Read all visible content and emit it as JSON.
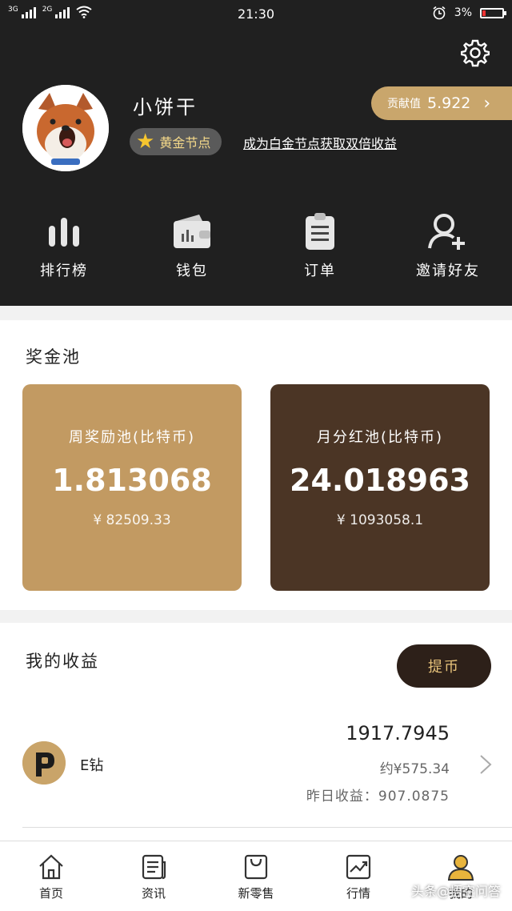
{
  "status_bar": {
    "net1": "3G",
    "net2": "2G",
    "time": "21:30",
    "battery_text": "3%"
  },
  "header": {
    "username": "小饼干",
    "badge_label": "黄金节点",
    "promo_link": "成为白金节点获取双倍收益",
    "contribution_label": "贡献值",
    "contribution_value": "5.922"
  },
  "quick_actions": [
    {
      "label": "排行榜",
      "icon": "bar-chart-icon"
    },
    {
      "label": "钱包",
      "icon": "wallet-icon"
    },
    {
      "label": "订单",
      "icon": "clipboard-icon"
    },
    {
      "label": "邀请好友",
      "icon": "add-user-icon"
    }
  ],
  "pool": {
    "title": "奖金池",
    "cards": [
      {
        "name": "周奖励池(比特币)",
        "amount": "1.813068",
        "cny": "¥ 82509.33",
        "color": "#c29a62"
      },
      {
        "name": "月分红池(比特币)",
        "amount": "24.018963",
        "cny": "¥ 1093058.1",
        "color": "#4b3525"
      }
    ]
  },
  "income": {
    "title": "我的收益",
    "withdraw_label": "提币",
    "coin": {
      "name": "E钻",
      "amount": "1917.7945",
      "cny": "约¥575.34",
      "yesterday": "昨日收益：907.0875"
    }
  },
  "tabs": [
    {
      "label": "首页",
      "icon": "home-icon"
    },
    {
      "label": "资讯",
      "icon": "news-icon"
    },
    {
      "label": "新零售",
      "icon": "shopping-bag-icon"
    },
    {
      "label": "行情",
      "icon": "trend-chart-icon"
    },
    {
      "label": "我的",
      "icon": "user-icon"
    }
  ],
  "watermark": "头条@悟空问答",
  "colors": {
    "accent": "#c9a66c",
    "dark": "#202020",
    "badge_text": "#f5d98a"
  }
}
